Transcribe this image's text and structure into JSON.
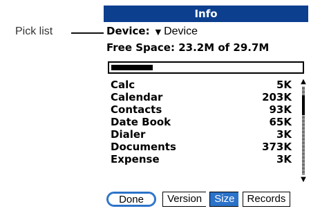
{
  "callout": {
    "label": "Pick list"
  },
  "window": {
    "title": "Info"
  },
  "device_row": {
    "label": "Device:",
    "value": "Device"
  },
  "free_space": {
    "text": "Free Space: 23.2M of 29.7M",
    "used_fraction": 0.22
  },
  "apps": [
    {
      "name": "Calc",
      "size": "5K"
    },
    {
      "name": "Calendar",
      "size": "203K"
    },
    {
      "name": "Contacts",
      "size": "93K"
    },
    {
      "name": "Date Book",
      "size": "65K"
    },
    {
      "name": "Dialer",
      "size": "3K"
    },
    {
      "name": "Documents",
      "size": "373K"
    },
    {
      "name": "Expense",
      "size": "3K"
    }
  ],
  "buttons": {
    "done": "Done",
    "version": "Version",
    "size": "Size",
    "records": "Records",
    "selected": "size"
  },
  "colors": {
    "title_bar": "#0d3f8f",
    "accent": "#2b72c9"
  },
  "icons": {
    "dropdown": "triangle-down-icon",
    "scroll_up": "arrow-up-icon",
    "scroll_down": "arrow-down-icon"
  }
}
